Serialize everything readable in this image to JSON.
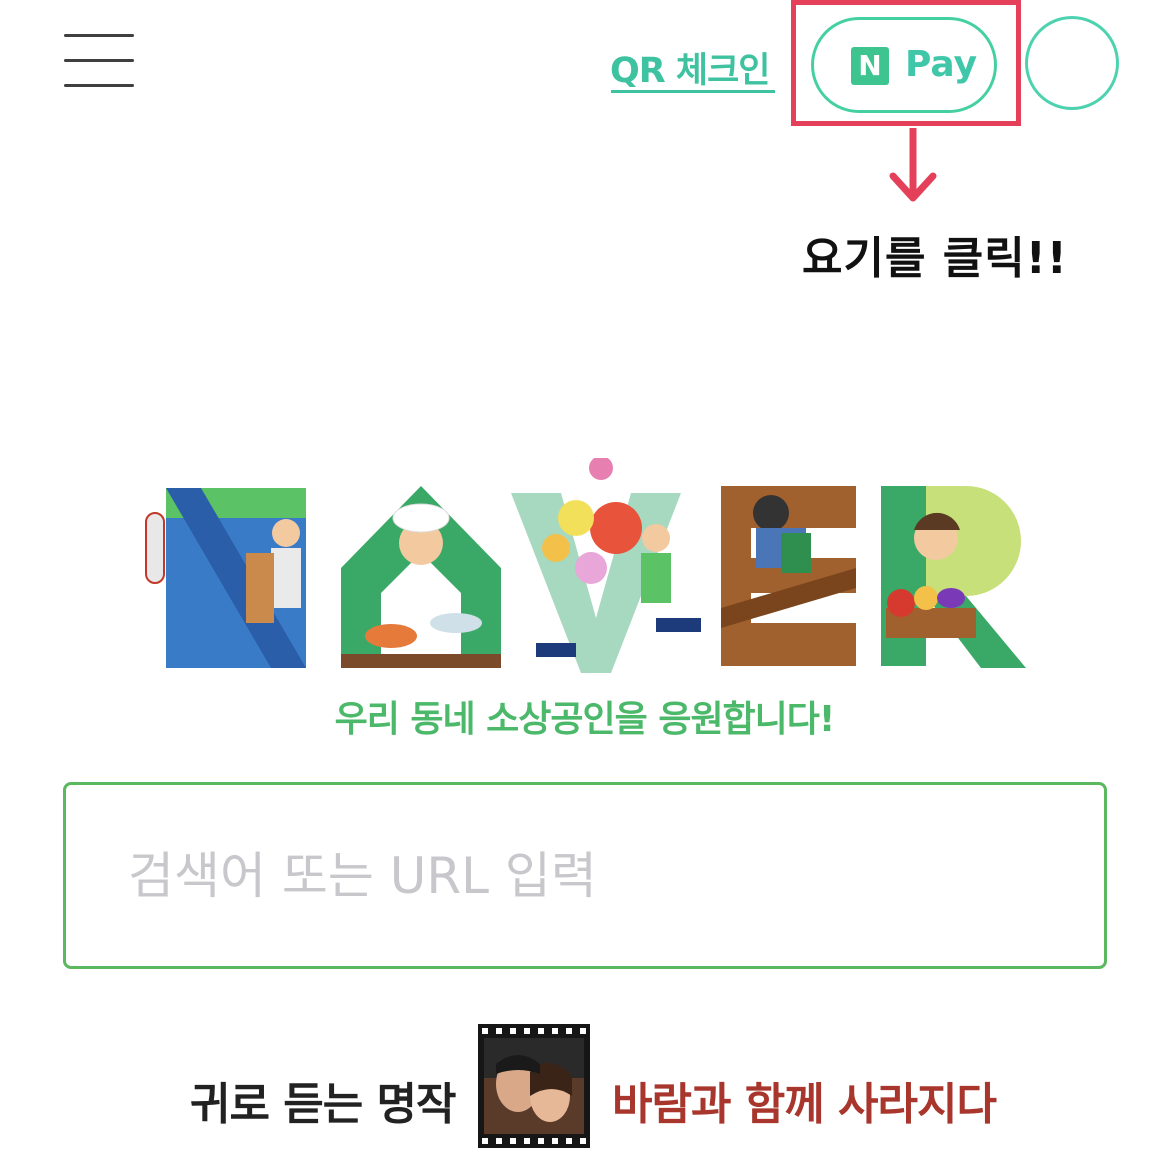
{
  "header": {
    "qr_checkin_label": "QR 체크인",
    "npay": {
      "logo_letter": "N",
      "label": "Pay"
    }
  },
  "annotation": {
    "text": "요기를 클릭!!",
    "color": "#e5405a"
  },
  "logo": {
    "letters": [
      "N",
      "A",
      "V",
      "E",
      "R"
    ]
  },
  "slogan": "우리 동네 소상공인을 응원합니다!",
  "search": {
    "placeholder": "검색어 또는 URL 입력",
    "value": ""
  },
  "promo": {
    "label": "귀로 듣는 명작",
    "title": "바람과 함께 사라지다"
  },
  "colors": {
    "brand_green": "#5cb85f",
    "npay_green": "#3ec48f",
    "qr_teal": "#3ec2a0",
    "highlight_red": "#e5405a",
    "promo_title_red": "#a8362c"
  },
  "icons": [
    "hamburger-menu-icon",
    "npay-logo-icon",
    "down-arrow-icon"
  ]
}
